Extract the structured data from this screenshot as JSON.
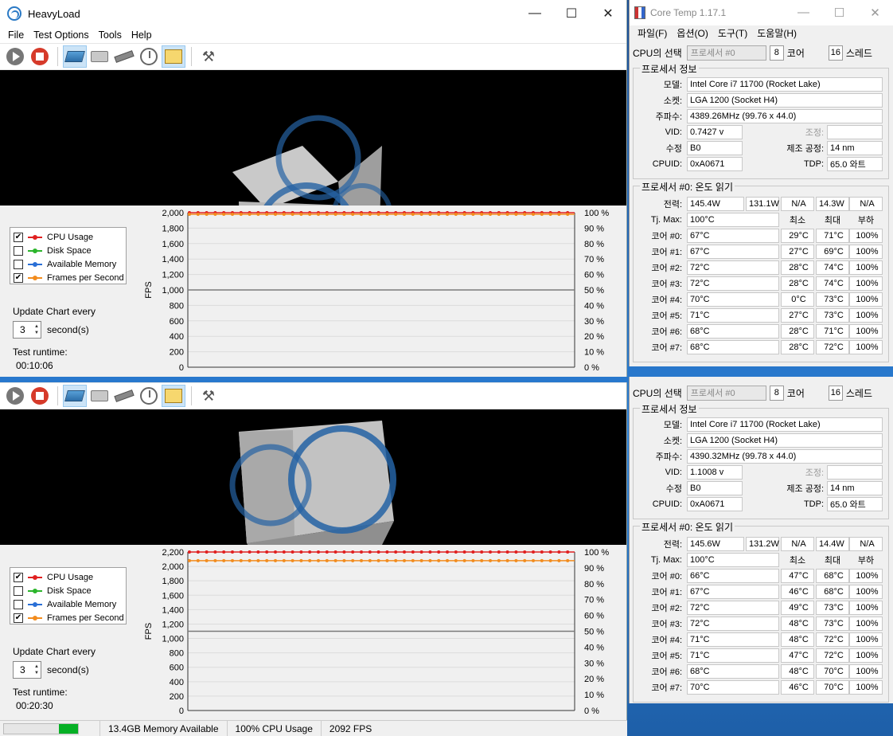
{
  "heavyload": {
    "title": "HeavyLoad",
    "menu": [
      "File",
      "Test Options",
      "Tools",
      "Help"
    ],
    "legend": [
      {
        "label": "CPU Usage",
        "checked": true,
        "color": "#e02020"
      },
      {
        "label": "Disk Space",
        "checked": false,
        "color": "#2bb52b"
      },
      {
        "label": "Available Memory",
        "checked": false,
        "color": "#2a6fd6"
      },
      {
        "label": "Frames per Second",
        "checked": true,
        "color": "#f28c1e"
      }
    ],
    "update_label": "Update Chart every",
    "update_value": "3",
    "seconds_label": "second(s)",
    "runtime_label": "Test runtime:",
    "icons": [
      "play-icon",
      "stop-icon",
      "cpu-icon",
      "disk-icon",
      "memory-icon",
      "gauge-icon",
      "chart-icon",
      "tools-icon"
    ]
  },
  "chart_top": {
    "runtime": "00:10:06",
    "ylabel_left": "FPS",
    "ylabel_right": "CPU Usage",
    "left_ticks": [
      "2,000",
      "1,800",
      "1,600",
      "1,400",
      "1,200",
      "1,000",
      "800",
      "600",
      "400",
      "200",
      "0"
    ],
    "right_ticks": [
      "100 %",
      "90 %",
      "80 %",
      "70 %",
      "60 %",
      "50 %",
      "40 %",
      "30 %",
      "20 %",
      "10 %",
      "0 %"
    ]
  },
  "chart_bottom": {
    "runtime": "00:20:30",
    "ylabel_left": "FPS",
    "ylabel_right": "CPU Usage",
    "left_ticks": [
      "2,200",
      "2,000",
      "1,800",
      "1,600",
      "1,400",
      "1,200",
      "1,000",
      "800",
      "600",
      "400",
      "200",
      "0"
    ],
    "right_ticks": [
      "100 %",
      "90 %",
      "80 %",
      "70 %",
      "60 %",
      "50 %",
      "40 %",
      "30 %",
      "20 %",
      "10 %",
      "0 %"
    ]
  },
  "statusbar": {
    "memory": "13.4GB Memory Available",
    "cpu": "100% CPU Usage",
    "fps": "2092 FPS"
  },
  "coretemp_top": {
    "title": "Core Temp 1.17.1",
    "menu": [
      "파일(F)",
      "옵션(O)",
      "도구(T)",
      "도움말(H)"
    ],
    "cpu_select_label": "CPU의 선택",
    "processor_combo": "프로세서 #0",
    "cores_count": "8",
    "cores_label": "코어",
    "threads_count": "16",
    "threads_label": "스레드",
    "info_title": "프로세서 정보",
    "model_label": "모델:",
    "model": "Intel Core i7 11700 (Rocket Lake)",
    "socket_label": "소켓:",
    "socket": "LGA 1200 (Socket H4)",
    "freq_label": "주파수:",
    "freq": "4389.26MHz (99.76 x 44.0)",
    "vid_label": "VID:",
    "vid": "0.7427 v",
    "mod_label": "조정:",
    "mod": "",
    "rev_label": "수정",
    "rev": "B0",
    "lith_label": "제조 공정:",
    "lith": "14 nm",
    "cpuid_label": "CPUID:",
    "cpuid": "0xA0671",
    "tdp_label": "TDP:",
    "tdp": "65.0 와트",
    "temp_title": "프로세서 #0: 온도 읽기",
    "power_label": "전력:",
    "power": [
      "145.4W",
      "131.1W",
      "N/A",
      "14.3W",
      "N/A"
    ],
    "tjmax_label": "Tj. Max:",
    "tjmax": "100°C",
    "hdr_min": "최소",
    "hdr_max": "최대",
    "hdr_load": "부하",
    "cores": [
      {
        "label": "코어 #0:",
        "temp": "67°C",
        "min": "29°C",
        "max": "71°C",
        "load": "100%"
      },
      {
        "label": "코어 #1:",
        "temp": "67°C",
        "min": "27°C",
        "max": "69°C",
        "load": "100%"
      },
      {
        "label": "코어 #2:",
        "temp": "72°C",
        "min": "28°C",
        "max": "74°C",
        "load": "100%"
      },
      {
        "label": "코어 #3:",
        "temp": "72°C",
        "min": "28°C",
        "max": "74°C",
        "load": "100%"
      },
      {
        "label": "코어 #4:",
        "temp": "70°C",
        "min": "0°C",
        "max": "73°C",
        "load": "100%"
      },
      {
        "label": "코어 #5:",
        "temp": "71°C",
        "min": "27°C",
        "max": "73°C",
        "load": "100%"
      },
      {
        "label": "코어 #6:",
        "temp": "68°C",
        "min": "28°C",
        "max": "71°C",
        "load": "100%"
      },
      {
        "label": "코어 #7:",
        "temp": "68°C",
        "min": "28°C",
        "max": "72°C",
        "load": "100%"
      }
    ]
  },
  "coretemp_bottom": {
    "cpu_select_label": "CPU의 선택",
    "processor_combo": "프로세서 #0",
    "cores_count": "8",
    "cores_label": "코어",
    "threads_count": "16",
    "threads_label": "스레드",
    "info_title": "프로세서 정보",
    "model_label": "모델:",
    "model": "Intel Core i7 11700 (Rocket Lake)",
    "socket_label": "소켓:",
    "socket": "LGA 1200 (Socket H4)",
    "freq_label": "주파수:",
    "freq": "4390.32MHz (99.78 x 44.0)",
    "vid_label": "VID:",
    "vid": "1.1008 v",
    "mod_label": "조정:",
    "mod": "",
    "rev_label": "수정",
    "rev": "B0",
    "lith_label": "제조 공정:",
    "lith": "14 nm",
    "cpuid_label": "CPUID:",
    "cpuid": "0xA0671",
    "tdp_label": "TDP:",
    "tdp": "65.0 와트",
    "temp_title": "프로세서 #0: 온도 읽기",
    "power_label": "전력:",
    "power": [
      "145.6W",
      "131.2W",
      "N/A",
      "14.4W",
      "N/A"
    ],
    "tjmax_label": "Tj. Max:",
    "tjmax": "100°C",
    "hdr_min": "최소",
    "hdr_max": "최대",
    "hdr_load": "부하",
    "cores": [
      {
        "label": "코어 #0:",
        "temp": "66°C",
        "min": "47°C",
        "max": "68°C",
        "load": "100%"
      },
      {
        "label": "코어 #1:",
        "temp": "67°C",
        "min": "46°C",
        "max": "68°C",
        "load": "100%"
      },
      {
        "label": "코어 #2:",
        "temp": "72°C",
        "min": "49°C",
        "max": "73°C",
        "load": "100%"
      },
      {
        "label": "코어 #3:",
        "temp": "72°C",
        "min": "48°C",
        "max": "73°C",
        "load": "100%"
      },
      {
        "label": "코어 #4:",
        "temp": "71°C",
        "min": "48°C",
        "max": "72°C",
        "load": "100%"
      },
      {
        "label": "코어 #5:",
        "temp": "71°C",
        "min": "47°C",
        "max": "72°C",
        "load": "100%"
      },
      {
        "label": "코어 #6:",
        "temp": "68°C",
        "min": "48°C",
        "max": "70°C",
        "load": "100%"
      },
      {
        "label": "코어 #7:",
        "temp": "70°C",
        "min": "46°C",
        "max": "70°C",
        "load": "100%"
      }
    ]
  }
}
